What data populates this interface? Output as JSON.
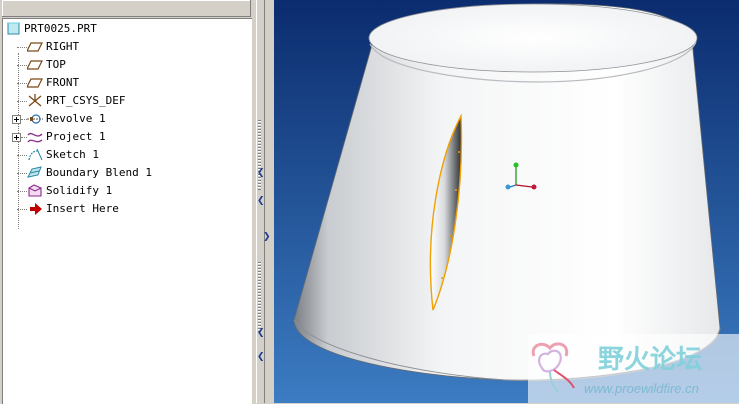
{
  "model_tree": {
    "root": "PRT0025.PRT",
    "items": [
      {
        "label": "RIGHT",
        "icon": "datum-plane-icon",
        "expandable": false
      },
      {
        "label": "TOP",
        "icon": "datum-plane-icon",
        "expandable": false
      },
      {
        "label": "FRONT",
        "icon": "datum-plane-icon",
        "expandable": false
      },
      {
        "label": "PRT_CSYS_DEF",
        "icon": "coordinate-system-icon",
        "expandable": false
      },
      {
        "label": "Revolve 1",
        "icon": "revolve-icon",
        "expandable": true
      },
      {
        "label": "Project 1",
        "icon": "project-curve-icon",
        "expandable": true
      },
      {
        "label": "Sketch 1",
        "icon": "sketch-icon",
        "expandable": false
      },
      {
        "label": "Boundary Blend 1",
        "icon": "boundary-blend-icon",
        "expandable": false
      },
      {
        "label": "Solidify 1",
        "icon": "solidify-icon",
        "expandable": false
      },
      {
        "label": "Insert Here",
        "icon": "insert-arrow-icon",
        "expandable": false
      }
    ]
  },
  "watermark": {
    "title": "野火论坛",
    "url": "www.proewildfire.cn"
  },
  "colors": {
    "viewport_top": "#0a2a6b",
    "viewport_bottom": "#3f7fc4",
    "highlight_edge": "#f0a000",
    "insert_arrow": "#c00000"
  }
}
